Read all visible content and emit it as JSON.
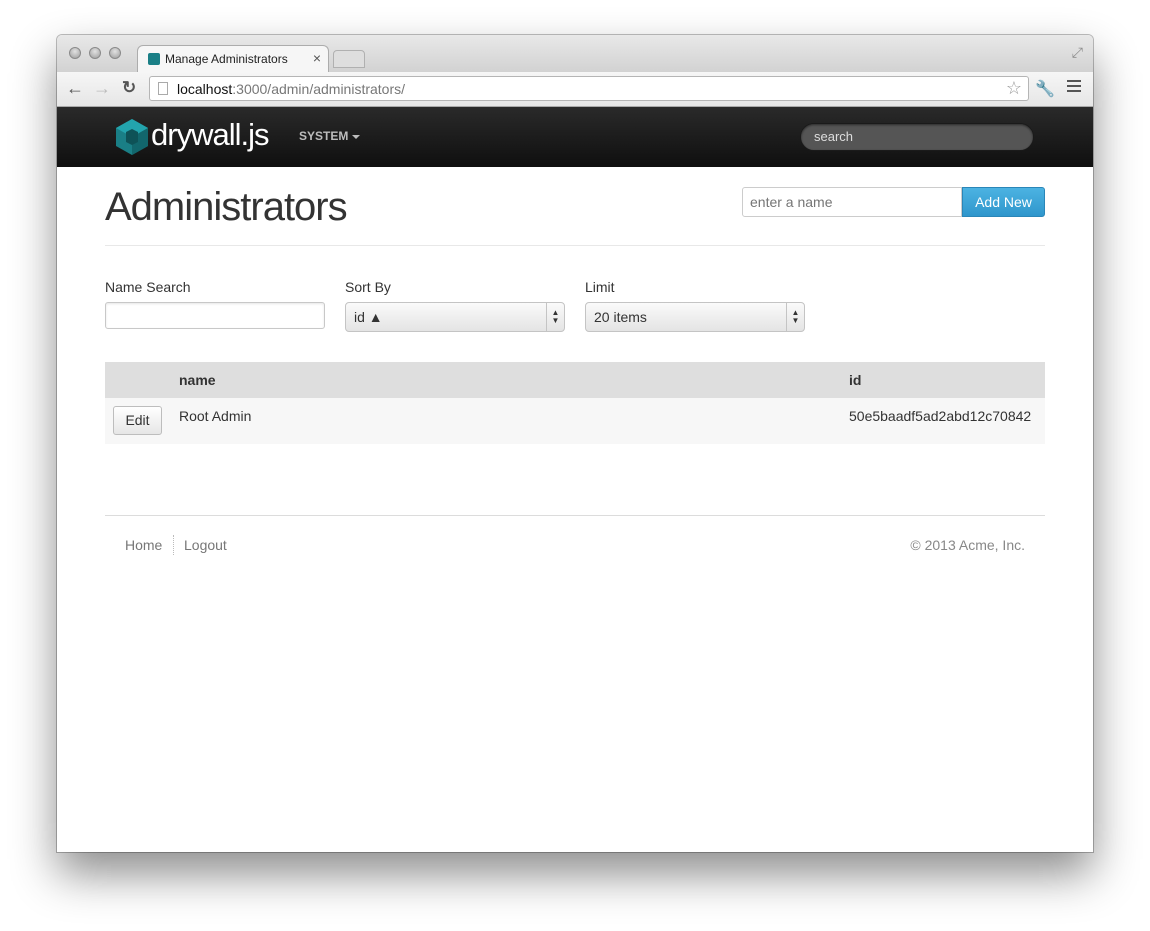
{
  "browser": {
    "tab_title": "Manage Administrators",
    "tab_close": "×",
    "url_host": "localhost",
    "url_path": ":3000/admin/administrators/"
  },
  "navbar": {
    "brand": "drywall.js",
    "menu_system": "SYSTEM",
    "search_placeholder": "search"
  },
  "header": {
    "title": "Administrators",
    "new_name_placeholder": "enter a name",
    "add_new_label": "Add New"
  },
  "filters": {
    "name_search_label": "Name Search",
    "sort_by_label": "Sort By",
    "sort_by_value": "id ▲",
    "limit_label": "Limit",
    "limit_value": "20 items"
  },
  "table": {
    "columns": [
      "",
      "name",
      "id"
    ],
    "rows": [
      {
        "action": "Edit",
        "name": "Root Admin",
        "id": "50e5baadf5ad2abd12c70842"
      }
    ]
  },
  "footer": {
    "links": [
      "Home",
      "Logout"
    ],
    "copyright": "© 2013 Acme, Inc."
  },
  "colors": {
    "accent": "#2f96cc",
    "navbar": "#1a1a1a",
    "logo": "#1a7f86"
  }
}
